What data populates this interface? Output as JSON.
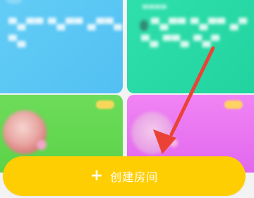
{
  "colors": {
    "card_top_left": "#5bc8f5",
    "card_top_right": "#27d8a6",
    "card_bottom_left": "#65d852",
    "card_bottom_right": "#ea76f1",
    "create_button": "#ffce02",
    "annotation_arrow": "#ea4335"
  },
  "icons": {
    "create_button_icon": "plus-icon",
    "annotation": "arrow-icon"
  },
  "create_button": {
    "icon_glyph": "+",
    "label": "创建房间"
  }
}
